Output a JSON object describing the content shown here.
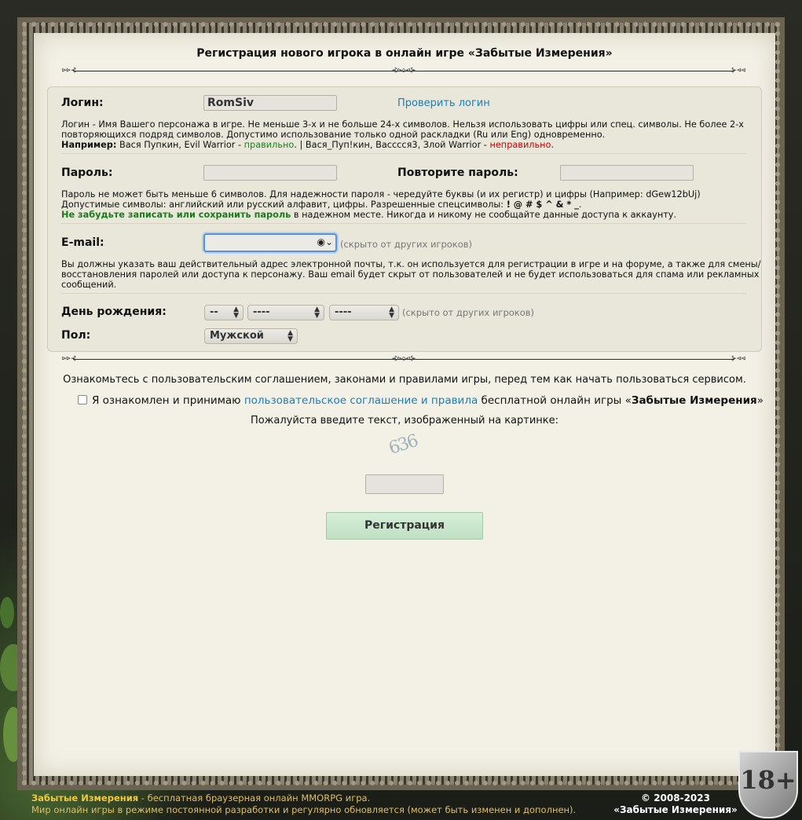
{
  "title": "Регистрация нового игрока в онлайн игре «Забытые Измерения»",
  "divider": {
    "end_left": "⊳⊳⊰",
    "end_right": "⊱⊲⊲",
    "middle": "⊰⊳◇⊲⊱"
  },
  "login": {
    "label": "Логин:",
    "value": "RomSiv",
    "check_link": "Проверить логин",
    "hint_line1": "Логин - Имя Вашего персонажа в игре. Не меньше 3-х и не больше 24-х символов. Нельзя использовать цифры или спец. символы. Не более 2-х",
    "hint_line2": "повторяющихся подряд символов. Допустимо использование только одной раскладки (Ru или Eng) одновременно.",
    "example_label": "Например:",
    "example_good": "Вася Пупкин, Evil Warrior - ",
    "example_good_word": "правильно",
    "example_bad": ". | Вася_Пуп!кин, Васссся3, Злой Warrior - ",
    "example_bad_word": "неправильно",
    "example_end": "."
  },
  "password": {
    "label": "Пароль:",
    "repeat_label": "Повторите пароль:",
    "hint_line1": "Пароль не может быть меньше 6 символов. Для надежности пароля - чередуйте буквы (и их регистр) и цифры (Например: dGew12bUj)",
    "hint_line2_a": "Допустимые символы: английский или русский алфавит, цифры. Разрешенные спецсимволы: ",
    "hint_line2_b": "! @ # $ ^ & * _",
    "hint_line2_c": ".",
    "hint_line3_a": "Не забудьте записать или сохранить пароль",
    "hint_line3_b": " в надежном месте. Никогда и никому не сообщайте данные доступа к аккаунту."
  },
  "email": {
    "label": "E-mail:",
    "value": "",
    "icon": "person-circle-icon",
    "hidden_note": "(скрыто от других игроков)",
    "hint_line1": "Вы должны указать ваш действительный адрес электронной почты, т.к. он используется для регистрации в игре и на форуме, а также для смены/",
    "hint_line2": "восстановления паролей или доступа к персонажу. Ваш email будет скрыт от пользователей и не будет использоваться для спама или рекламных",
    "hint_line3": "сообщений."
  },
  "birthday": {
    "label": "День рождения:",
    "day": "--",
    "month": "----",
    "year": "----",
    "hidden_note": "(скрыто от других игроков)"
  },
  "gender": {
    "label": "Пол:",
    "value": "Мужской"
  },
  "agreement": {
    "intro": "Ознакомьтесь с пользовательским соглашением, законами и правилами игры, перед тем как начать пользоваться сервисом.",
    "accept_prefix": "Я ознакомлен и принимаю ",
    "accept_link": "пользовательское соглашение и правила",
    "accept_middle": " бесплатной онлайн игры «",
    "accept_game": "Забытые Измерения",
    "accept_end": "»",
    "checked": false
  },
  "captcha": {
    "prompt": "Пожалуйста введите текст, изображенный на картинке:",
    "image_text": "636",
    "value": ""
  },
  "submit_label": "Регистрация",
  "footer": {
    "game_name": "Забытые Измерения",
    "line1_rest": " - бесплатная браузерная онлайн MMORPG игра.",
    "line2": "Мир онлайн игры в режиме постоянной разработки и регулярно обновляется (может быть изменен и дополнен).",
    "copyright": "© 2008-2023",
    "copyright_name": "«Забытые Измерения»",
    "age_badge": "18+"
  },
  "colors": {
    "link": "#1a7dc0",
    "ok": "#208020",
    "bad": "#d00000",
    "accent_green": "#1a7d1a",
    "footer_text": "#e0c060"
  }
}
